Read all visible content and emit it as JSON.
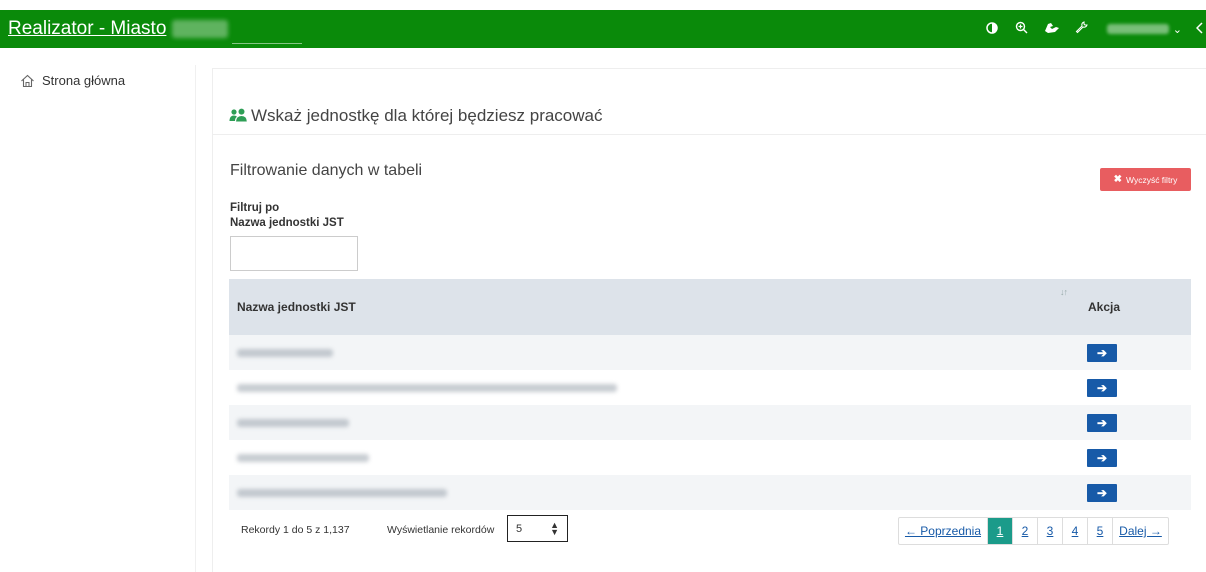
{
  "header": {
    "brand": "Realizator - Miasto",
    "icons": [
      "contrast-icon",
      "zoom-icon",
      "sign-language-icon",
      "wrench-icon"
    ],
    "user_menu_caret": "⌄",
    "accent_color": "#0a8a0a"
  },
  "sidebar": {
    "items": [
      {
        "label": "Strona główna",
        "icon": "home-icon"
      }
    ]
  },
  "panel": {
    "title": "Wskaż jednostkę dla której będziesz pracować",
    "title_icon": "users-icon"
  },
  "filter": {
    "title": "Filtrowanie danych w tabeli",
    "clear_label": "Wyczyść filtry",
    "by_label": "Filtruj po",
    "field_label": "Nazwa jednostki JST",
    "value": ""
  },
  "table": {
    "columns": [
      "Nazwa jednostki JST",
      "Akcja"
    ],
    "rows": [
      {
        "name": ""
      },
      {
        "name": ""
      },
      {
        "name": ""
      },
      {
        "name": ""
      },
      {
        "name": ""
      }
    ],
    "action_glyph": "➔"
  },
  "footer": {
    "records_text": "Rekordy 1 do 5 z 1,137",
    "per_page_label": "Wyświetlanie rekordów",
    "per_page_value": "5",
    "pagination": {
      "prev": "← Poprzednia",
      "pages": [
        "1",
        "2",
        "3",
        "4",
        "5"
      ],
      "active": "1",
      "next": "Dalej →"
    }
  }
}
